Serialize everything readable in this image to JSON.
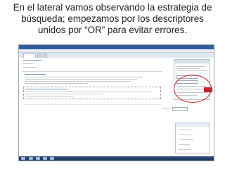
{
  "caption": {
    "line1": "En el lateral vamos observando la estrategia de",
    "line2": "búsqueda; empezamos por los descriptores",
    "line3": "unidos por “OR” para evitar errores."
  },
  "colors": {
    "annotation": "#d9262b",
    "window_titlebar": "#2e5d9a",
    "taskbar": "#1c3358"
  }
}
